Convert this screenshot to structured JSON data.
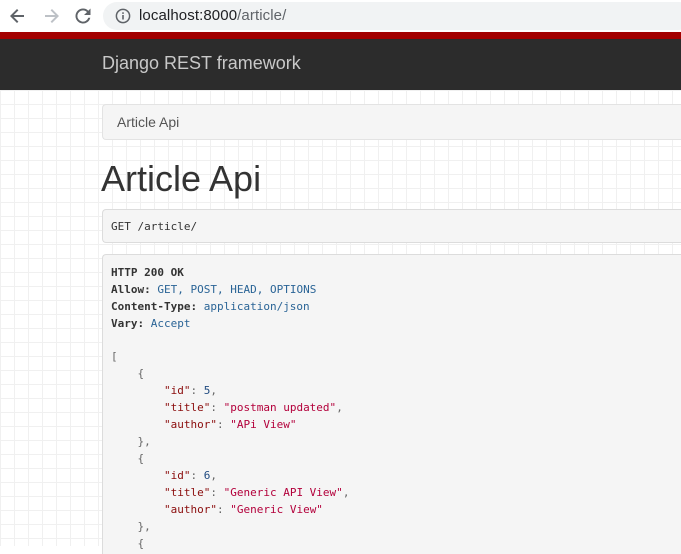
{
  "browser": {
    "url_host": "localhost:8000",
    "url_path": "/article/"
  },
  "navbar": {
    "brand": "Django REST framework"
  },
  "breadcrumb": {
    "item": "Article Api"
  },
  "page": {
    "title": "Article Api"
  },
  "request": {
    "method": "GET",
    "path": "/article/"
  },
  "response": {
    "status": "HTTP 200 OK",
    "headers": [
      {
        "name": "Allow:",
        "value": "GET, POST, HEAD, OPTIONS"
      },
      {
        "name": "Content-Type:",
        "value": "application/json"
      },
      {
        "name": "Vary:",
        "value": "Accept"
      }
    ],
    "body": {
      "open_bracket": "[",
      "open_brace": "{",
      "close_brace": "},",
      "items": [
        {
          "id_key": "\"id\"",
          "id_val": "5",
          "title_key": "\"title\"",
          "title_val": "\"postman updated\"",
          "author_key": "\"author\"",
          "author_val": "\"APi View\""
        },
        {
          "id_key": "\"id\"",
          "id_val": "6",
          "title_key": "\"title\"",
          "title_val": "\"Generic API View\"",
          "author_key": "\"author\"",
          "author_val": "\"Generic View\""
        }
      ]
    }
  },
  "colors": {
    "navbar_bg": "#2c2c2c",
    "navbar_accent": "#a30000",
    "json_key": "#8b0d0d",
    "json_string": "#b3003b",
    "json_number": "#1f4a80",
    "header_value": "#2a6496"
  },
  "icons": [
    "back-arrow-icon",
    "forward-arrow-icon",
    "reload-icon",
    "info-icon"
  ]
}
